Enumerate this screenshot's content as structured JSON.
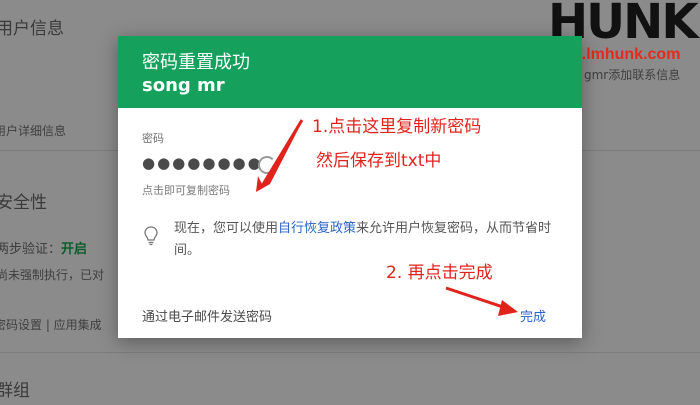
{
  "background": {
    "user_info_title": "用户信息",
    "add_contact": "gmr添加联系信息",
    "user_detail": "用户详细信息",
    "security_title": "安全性",
    "two_step_label": "两步验证：",
    "two_step_status": "开启",
    "not_enforced": "尚未强制执行，已对",
    "links": "密码设置 | 应用集成",
    "group_title": "群组"
  },
  "logo": {
    "name": "HUNK",
    "url": "www.lmhunk.com"
  },
  "dialog": {
    "title": "密码重置成功",
    "username": "song mr",
    "password_label": "密码",
    "password_value": "●●●●●●●●",
    "password_hint": "点击即可复制密码",
    "info_prefix": "现在，您可以使用",
    "info_link": "自行恢复政策",
    "info_suffix": "来允许用户恢复密码，从而节省时间。",
    "email_button": "通过电子邮件发送密码",
    "done_button": "完成"
  },
  "annotations": {
    "step1_line1": "1.点击这里复制新密码",
    "step1_line2": "然后保存到txt中",
    "step2": "2. 再点击完成"
  },
  "colors": {
    "header_green": "#15a15c",
    "link_blue": "#2a63c7",
    "annotation_red": "#e0241c"
  }
}
